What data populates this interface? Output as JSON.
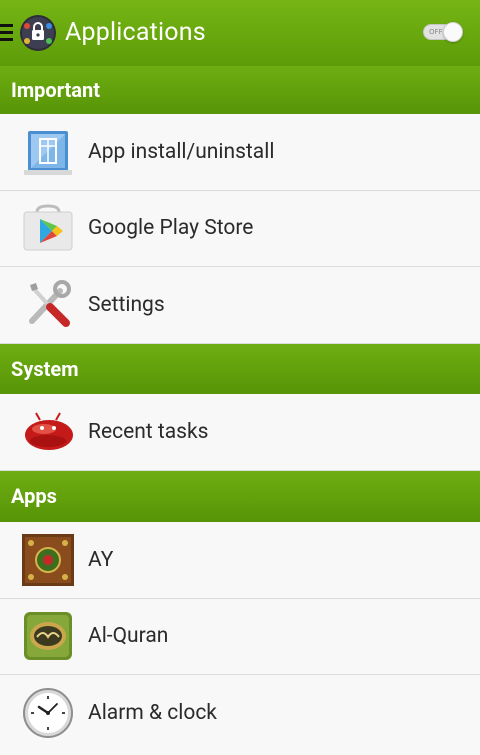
{
  "appbar": {
    "title": "Applications",
    "menu_icon": "menu-icon",
    "logo_icon": "app-logo-icon",
    "toggle_label": "OFF"
  },
  "sections": [
    {
      "header": "Important",
      "items": [
        {
          "label": "App install/uninstall",
          "icon": "app-install-icon"
        },
        {
          "label": "Google Play Store",
          "icon": "play-store-icon"
        },
        {
          "label": "Settings",
          "icon": "settings-tools-icon"
        }
      ]
    },
    {
      "header": "System",
      "items": [
        {
          "label": "Recent tasks",
          "icon": "jellybean-icon"
        }
      ]
    },
    {
      "header": "Apps",
      "items": [
        {
          "label": "AY",
          "icon": "ay-app-icon"
        },
        {
          "label": "Al-Quran",
          "icon": "quran-icon"
        },
        {
          "label": "Alarm & clock",
          "icon": "clock-icon"
        }
      ]
    }
  ],
  "colors": {
    "appbar_green": "#6aab10",
    "section_green": "#63a10c",
    "row_background": "#f8f8f8"
  }
}
